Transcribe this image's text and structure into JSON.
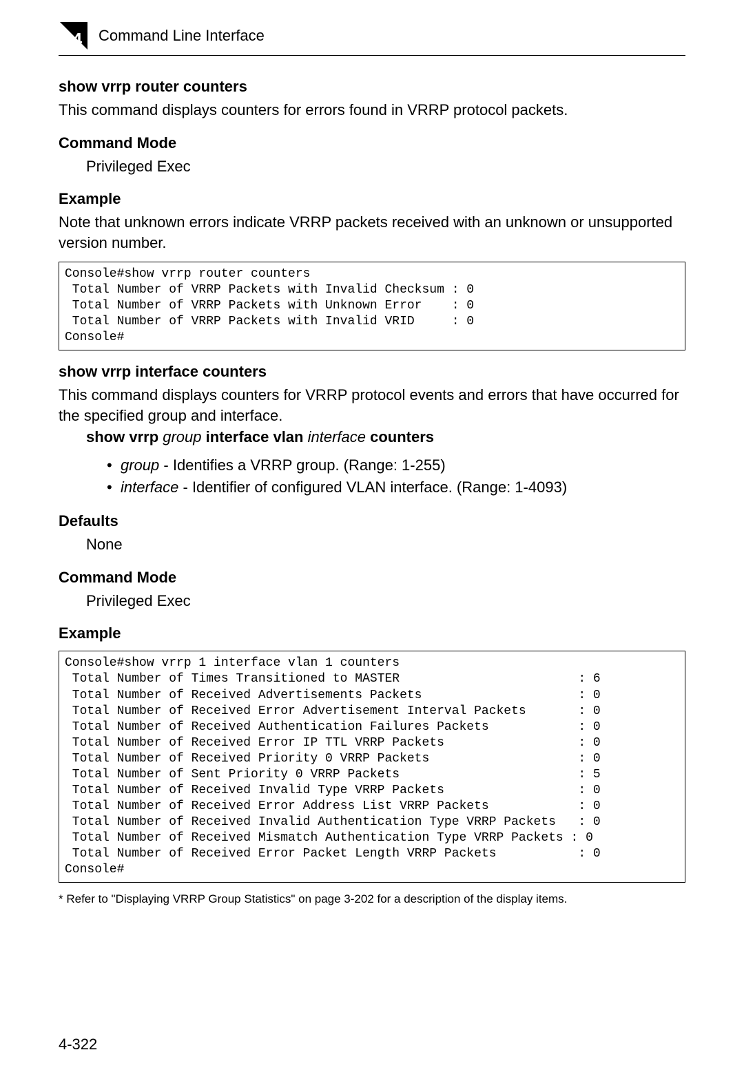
{
  "header": {
    "chapter_number": "4",
    "title": "Command Line Interface"
  },
  "section1": {
    "heading": "show vrrp router counters",
    "desc": "This command displays counters for errors found in VRRP protocol packets.",
    "mode_heading": "Command Mode",
    "mode_value": "Privileged Exec",
    "example_heading": "Example",
    "example_note": "Note that unknown errors indicate VRRP packets received with an unknown or unsupported version number.",
    "code": "Console#show vrrp router counters\n Total Number of VRRP Packets with Invalid Checksum : 0\n Total Number of VRRP Packets with Unknown Error    : 0\n Total Number of VRRP Packets with Invalid VRID     : 0\nConsole#"
  },
  "section2": {
    "heading": "show vrrp interface counters",
    "desc": "This command displays counters for VRRP protocol events and errors that have occurred for the specified group and interface.",
    "syntax": {
      "p1": "show vrrp ",
      "p2": "group",
      "p3": " interface vlan ",
      "p4": "interface",
      "p5": " counters"
    },
    "params": {
      "group_name": "group",
      "group_desc": " - Identifies a VRRP group. (Range: 1-255)",
      "iface_name": "interface",
      "iface_desc": " - Identifier of configured VLAN interface. (Range: 1-4093)"
    },
    "defaults_heading": "Defaults",
    "defaults_value": "None",
    "mode_heading": "Command Mode",
    "mode_value": "Privileged Exec",
    "example_heading": "Example",
    "code": "Console#show vrrp 1 interface vlan 1 counters\n Total Number of Times Transitioned to MASTER                        : 6\n Total Number of Received Advertisements Packets                     : 0\n Total Number of Received Error Advertisement Interval Packets       : 0\n Total Number of Received Authentication Failures Packets            : 0\n Total Number of Received Error IP TTL VRRP Packets                  : 0\n Total Number of Received Priority 0 VRRP Packets                    : 0\n Total Number of Sent Priority 0 VRRP Packets                        : 5\n Total Number of Received Invalid Type VRRP Packets                  : 0\n Total Number of Received Error Address List VRRP Packets            : 0\n Total Number of Received Invalid Authentication Type VRRP Packets   : 0\n Total Number of Received Mismatch Authentication Type VRRP Packets : 0\n Total Number of Received Error Packet Length VRRP Packets           : 0\nConsole#"
  },
  "footnote": "* Refer to \"Displaying VRRP Group Statistics\" on page 3-202 for a description of the display items.",
  "page_number": "4-322"
}
